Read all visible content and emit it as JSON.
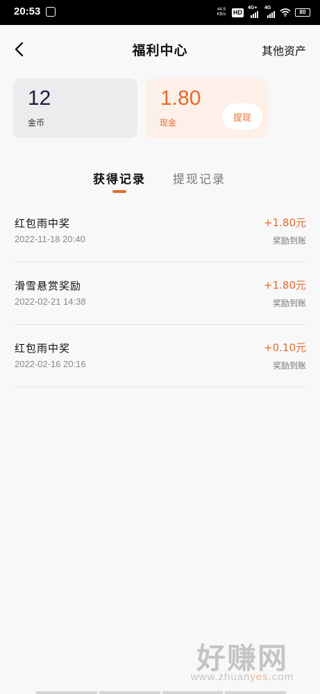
{
  "status_bar": {
    "time": "20:53",
    "net_speed_value": "44.9",
    "net_speed_unit": "KB/s",
    "hd_badge": "HD",
    "signal1_label": "4G+",
    "signal2_label": "4G",
    "battery": "80"
  },
  "header": {
    "title": "福利中心",
    "right_link": "其他资产"
  },
  "cards": {
    "coins": {
      "value": "12",
      "label": "金币"
    },
    "cash": {
      "value": "1.80",
      "label": "现金",
      "action": "提现"
    }
  },
  "tabs": [
    {
      "label": "获得记录",
      "active": true
    },
    {
      "label": "提现记录",
      "active": false
    }
  ],
  "records": [
    {
      "title": "红包雨中奖",
      "time": "2022-11-18 20:40",
      "amount": "+1.80元",
      "status": "奖励到账"
    },
    {
      "title": "滑雪悬赏奖励",
      "time": "2022-02-21 14:38",
      "amount": "+1.80元",
      "status": "奖励到账"
    },
    {
      "title": "红包雨中奖",
      "time": "2022-02-16 20:16",
      "amount": "+0.10元",
      "status": "奖励到账"
    }
  ],
  "watermark": {
    "text": "好赚网",
    "url_prefix": "www.zhuan",
    "url_highlight": "yes",
    "url_suffix": ".com"
  },
  "colors": {
    "accent": "#e46a2e",
    "coins_card_bg": "#ececef",
    "cash_card_bg": "#fdf0e9",
    "page_bg": "#f8f8f8"
  },
  "icons": {
    "back": "chevron-left-icon",
    "app_notification": "app-notification-icon",
    "wifi": "wifi-icon",
    "battery": "battery-icon"
  }
}
